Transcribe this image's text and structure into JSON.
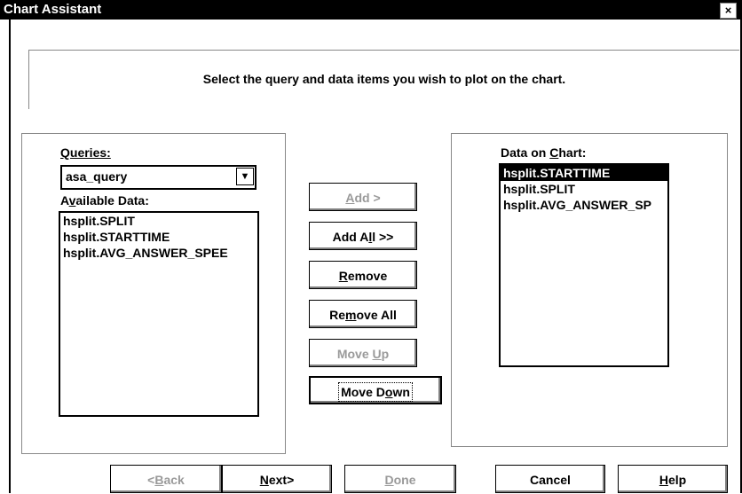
{
  "window": {
    "title": "Chart Assistant",
    "close_glyph": "×"
  },
  "instruction": "Select the query and data items you wish to plot on the chart.",
  "left_panel": {
    "queries_label": "Queries:",
    "query_value": "asa_query",
    "available_label_pre": "A",
    "available_label_u": "v",
    "available_label_post": "ailable Data:",
    "available_items": [
      "hsplit.SPLIT",
      "hsplit.STARTTIME",
      "hsplit.AVG_ANSWER_SPEE"
    ]
  },
  "middle_buttons": {
    "add_u": "A",
    "add_post": "dd >",
    "addall_pre": "Add A",
    "addall_u": "l",
    "addall_post": "l >>",
    "remove_u": "R",
    "remove_post": "emove",
    "removeall_pre": "Re",
    "removeall_u": "m",
    "removeall_post": "ove All",
    "moveup_pre": "Move ",
    "moveup_u": "U",
    "moveup_post": "p",
    "movedown_pre": "Move D",
    "movedown_u": "o",
    "movedown_post": "wn"
  },
  "right_panel": {
    "label_pre": "Data on ",
    "label_u": "C",
    "label_post": "hart:",
    "items": [
      "hsplit.STARTTIME",
      "hsplit.SPLIT",
      "hsplit.AVG_ANSWER_SP"
    ],
    "selected_index": 0
  },
  "footer": {
    "back_pre": "<",
    "back_u": "B",
    "back_post": "ack",
    "next_u": "N",
    "next_post": "ext>",
    "done_u": "D",
    "done_post": "one",
    "cancel": "Cancel",
    "help_u": "H",
    "help_post": "elp"
  }
}
